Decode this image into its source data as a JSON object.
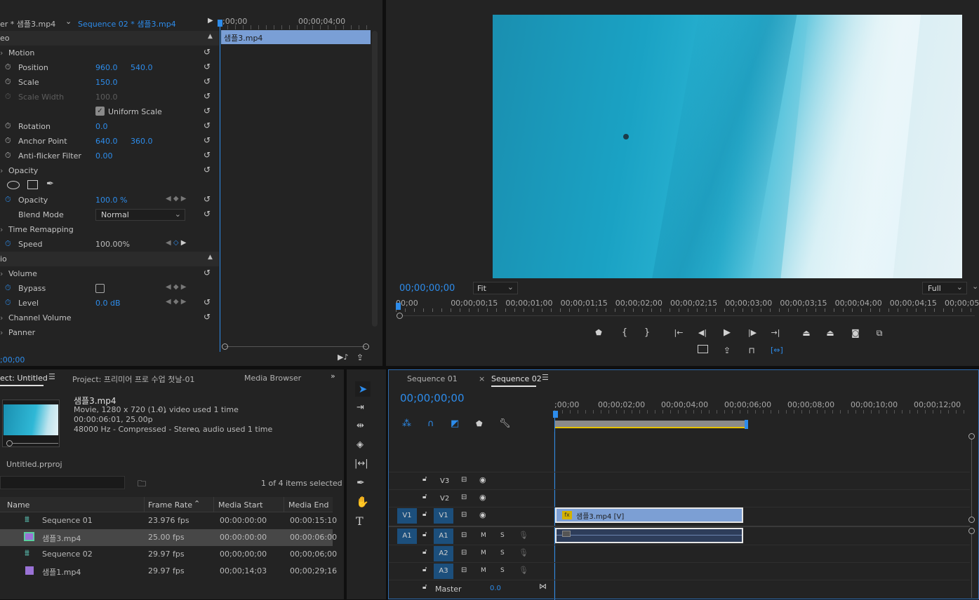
{
  "effect_controls": {
    "tab_source": "er * 샘플3.mp4",
    "tab_sequence": "Sequence 02 * 샘플3.mp4",
    "mini_timeline": {
      "t0": ";00;00",
      "t1": "00;00;04;00",
      "clip": "샘플3.mp4"
    },
    "video_header": "eo",
    "motion": "Motion",
    "position": {
      "label": "Position",
      "x": "960.0",
      "y": "540.0"
    },
    "scale": {
      "label": "Scale",
      "value": "150.0"
    },
    "scale_width": {
      "label": "Scale Width",
      "value": "100.0"
    },
    "uniform_scale": "Uniform Scale",
    "rotation": {
      "label": "Rotation",
      "value": "0.0"
    },
    "anchor_point": {
      "label": "Anchor Point",
      "x": "640.0",
      "y": "360.0"
    },
    "anti_flicker": {
      "label": "Anti-flicker Filter",
      "value": "0.00"
    },
    "opacity_group": "Opacity",
    "opacity": {
      "label": "Opacity",
      "value": "100.0 %"
    },
    "blend_mode": {
      "label": "Blend Mode",
      "value": "Normal"
    },
    "time_remapping": "Time Remapping",
    "speed": {
      "label": "Speed",
      "value": "100.00%"
    },
    "audio_header": "io",
    "volume": "Volume",
    "bypass": "Bypass",
    "level": {
      "label": "Level",
      "value": "0.0 dB"
    },
    "channel_volume": "Channel Volume",
    "panner": "Panner",
    "timecode": ";00;00"
  },
  "program": {
    "timecode": "00;00;00;00",
    "fit": "Fit",
    "quality": "Full",
    "ruler": [
      "00;00",
      "00;00;00;15",
      "00;00;01;00",
      "00;00;01;15",
      "00;00;02;00",
      "00;00;02;15",
      "00;00;03;00",
      "00;00;03;15",
      "00;00;04;00",
      "00;00;04;15",
      "00;00;05;00"
    ]
  },
  "project": {
    "tab_project": "ect: Untitled",
    "tab_project2": "Project: 프리미어 프로 수업 첫날-01",
    "tab_media": "Media Browser",
    "clip_name": "샘플3.mp4",
    "clip_info1": "Movie, 1280 x 720 (1.0)",
    "clip_info1b": ", video used 1 time",
    "clip_info2": "00:00:06:01, 25.00p",
    "clip_info3": "48000 Hz - Compressed - Stereo",
    "clip_info3b": ", audio used 1 time",
    "file": "Untitled.prproj",
    "selection": "1 of 4 items selected",
    "columns": {
      "name": "Name",
      "frame_rate": "Frame Rate",
      "media_start": "Media Start",
      "media_end": "Media End"
    },
    "items": [
      {
        "name": "Sequence 01",
        "fps": "23.976 fps",
        "start": "00:00:00:00",
        "end": "00:00:15:10",
        "icon": "sequence-icon"
      },
      {
        "name": "샘플3.mp4",
        "fps": "25.00 fps",
        "start": "00:00:00:00",
        "end": "00:00:06:00",
        "icon": "video-clip-icon"
      },
      {
        "name": "Sequence 02",
        "fps": "29.97 fps",
        "start": "00;00;00;00",
        "end": "00;00;06;00",
        "icon": "sequence-icon"
      },
      {
        "name": "샘플1.mp4",
        "fps": "29.97 fps",
        "start": "00;00;14;03",
        "end": "00;00;29;16",
        "icon": "video-clip-icon"
      }
    ]
  },
  "timeline": {
    "tab1": "Sequence 01",
    "tab2": "Sequence 02",
    "timecode": "00;00;00;00",
    "ruler": [
      ";00;00",
      "00;00;02;00",
      "00;00;04;00",
      "00;00;06;00",
      "00;00;08;00",
      "00;00;10;00",
      "00;00;12;00"
    ],
    "tracks": {
      "v3": "V3",
      "v2": "V2",
      "v1": "V1",
      "a1": "A1",
      "a2": "A2",
      "a3": "A3",
      "m": "M",
      "s": "S"
    },
    "video_clip": "샘플3.mp4 [V]",
    "master": "Master",
    "master_value": "0.0",
    "fx": "fx"
  }
}
